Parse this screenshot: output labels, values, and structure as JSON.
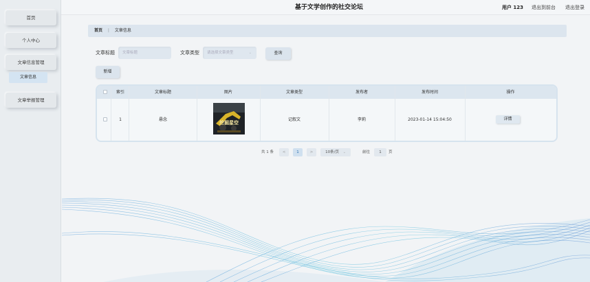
{
  "app": {
    "title": "基于文学创作的社交论坛",
    "user_label": "用户 123",
    "exit_admin": "退出到前台",
    "logout": "退出登录"
  },
  "sidebar": {
    "items": [
      {
        "label": "首页"
      },
      {
        "label": "个人中心"
      },
      {
        "label": "文章信息管理"
      },
      {
        "label": "文章举报管理"
      }
    ],
    "sub_items": [
      {
        "label": "文章信息"
      }
    ]
  },
  "breadcrumb": {
    "home": "首页",
    "separator": "⋮",
    "current": "文章信息"
  },
  "search": {
    "title_label": "文章标题",
    "title_placeholder": "文章标题",
    "type_label": "文章类型",
    "type_placeholder": "请选择文章类型",
    "query_button": "查询",
    "add_button": "新增"
  },
  "table": {
    "headers": [
      "索引",
      "文章标题",
      "图片",
      "文章类型",
      "发布者",
      "发布时间",
      "操作"
    ],
    "rows": [
      {
        "index": "1",
        "title": "悬念",
        "image_text": "挖掘星空",
        "type": "记叙文",
        "author": "李莉",
        "time": "2023-01-14 15:04:50",
        "action": "详情"
      }
    ]
  },
  "pagination": {
    "total": "共 1 条",
    "prev": "<",
    "page": "1",
    "next": ">",
    "page_size": "10条/页",
    "goto_label": "前往",
    "goto_value": "1",
    "page_suffix": "页"
  }
}
